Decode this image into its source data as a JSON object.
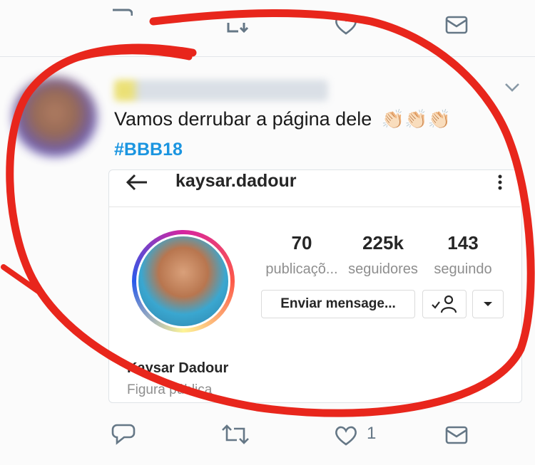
{
  "tweet": {
    "text": "Vamos derrubar a página dele",
    "emoji": "👏🏻👏🏻👏🏻",
    "hashtag": "#BBB18"
  },
  "instagram_card": {
    "username": "kaysar.dadour",
    "stats": [
      {
        "value": "70",
        "label": "publicaçõ..."
      },
      {
        "value": "225k",
        "label": "seguidores"
      },
      {
        "value": "143",
        "label": "seguindo"
      }
    ],
    "message_button": "Enviar mensage...",
    "full_name": "Kaysar Dadour",
    "category": "Figura pública"
  },
  "actions": {
    "like_count": "1"
  },
  "icons": [
    "reply-icon",
    "retweet-icon",
    "like-icon",
    "dm-icon",
    "caret-down-icon",
    "back-arrow-icon",
    "more-vertical-icon",
    "follow-check-icon",
    "dropdown-icon"
  ],
  "colors": {
    "link": "#1b95e0",
    "annotation": "#e8261c",
    "icon": "#657786"
  }
}
